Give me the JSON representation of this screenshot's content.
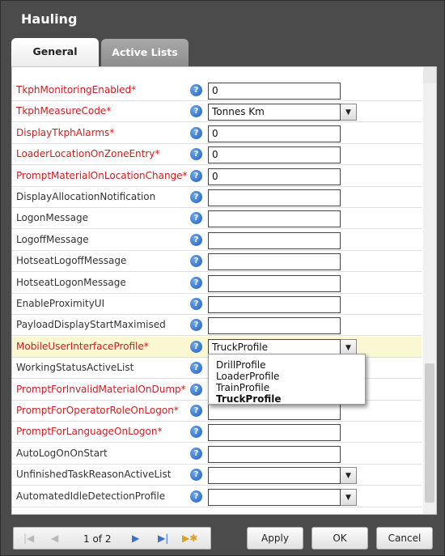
{
  "window": {
    "title": "Hauling"
  },
  "tabs": [
    {
      "label": "General"
    },
    {
      "label": "Active Lists"
    }
  ],
  "help_glyph": "?",
  "dropdown_arrow": "▼",
  "rows": [
    {
      "label": "TkphMonitoringEnabled*",
      "required": true,
      "value": "0",
      "type": "text"
    },
    {
      "label": "TkphMeasureCode*",
      "required": true,
      "value": "Tonnes Km",
      "type": "combo"
    },
    {
      "label": "DisplayTkphAlarms*",
      "required": true,
      "value": "0",
      "type": "text"
    },
    {
      "label": "LoaderLocationOnZoneEntry*",
      "required": true,
      "value": "0",
      "type": "text"
    },
    {
      "label": "PromptMaterialOnLocationChange*",
      "required": true,
      "value": "0",
      "type": "text"
    },
    {
      "label": "DisplayAllocationNotification",
      "required": false,
      "value": "",
      "type": "text"
    },
    {
      "label": "LogonMessage",
      "required": false,
      "value": "",
      "type": "text"
    },
    {
      "label": "LogoffMessage",
      "required": false,
      "value": "",
      "type": "text"
    },
    {
      "label": "HotseatLogoffMessage",
      "required": false,
      "value": "",
      "type": "text"
    },
    {
      "label": "HotseatLogonMessage",
      "required": false,
      "value": "",
      "type": "text"
    },
    {
      "label": "EnableProximityUI",
      "required": false,
      "value": "",
      "type": "text"
    },
    {
      "label": "PayloadDisplayStartMaximised",
      "required": false,
      "value": "",
      "type": "text"
    },
    {
      "label": "MobileUserInterfaceProfile*",
      "required": true,
      "value": "TruckProfile",
      "type": "combo",
      "selected": true
    },
    {
      "label": "WorkingStatusActiveList",
      "required": false,
      "value": "",
      "type": "text"
    },
    {
      "label": "PromptForInvalidMaterialOnDump*",
      "required": true,
      "value": "",
      "type": "text"
    },
    {
      "label": "PromptForOperatorRoleOnLogon*",
      "required": true,
      "value": "",
      "type": "text"
    },
    {
      "label": "PromptForLanguageOnLogon*",
      "required": true,
      "value": "",
      "type": "text"
    },
    {
      "label": "AutoLogOnOnStart",
      "required": false,
      "value": "",
      "type": "text"
    },
    {
      "label": "UnfinishedTaskReasonActiveList",
      "required": false,
      "value": "",
      "type": "combo"
    },
    {
      "label": "AutomatedIdleDetectionProfile",
      "required": false,
      "value": "",
      "type": "combo"
    }
  ],
  "dropdown": {
    "options": [
      "DrillProfile",
      "LoaderProfile",
      "TrainProfile",
      "TruckProfile"
    ],
    "current": "TruckProfile"
  },
  "pager": {
    "first_icon": "first-page-icon",
    "prev_icon": "prev-page-icon",
    "next_icon": "next-page-icon",
    "last_icon": "last-page-icon",
    "new_icon": "new-page-icon",
    "page_label": "1 of 2"
  },
  "buttons": {
    "apply": "Apply",
    "ok": "OK",
    "cancel": "Cancel"
  },
  "colors": {
    "required": "#d01c1c",
    "selected_row": "#fbf7d2",
    "help": "#1d5fc1"
  }
}
